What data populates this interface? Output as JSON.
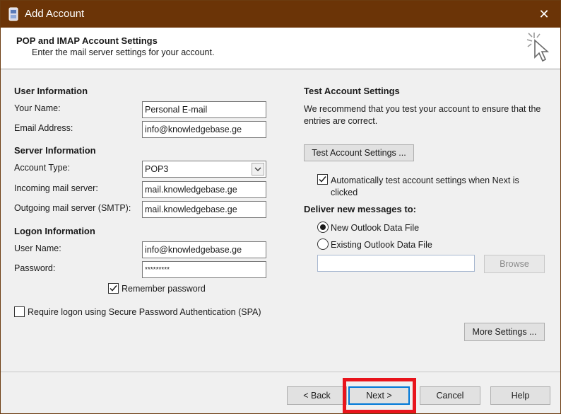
{
  "window": {
    "title": "Add Account",
    "close_label": "✕"
  },
  "header": {
    "title": "POP and IMAP Account Settings",
    "subtitle": "Enter the mail server settings for your account."
  },
  "user_info": {
    "heading": "User Information",
    "name_label": "Your Name:",
    "name_value": "Personal E-mail",
    "email_label": "Email Address:",
    "email_value": "info@knowledgebase.ge"
  },
  "server_info": {
    "heading": "Server Information",
    "account_type_label": "Account Type:",
    "account_type_value": "POP3",
    "incoming_label": "Incoming mail server:",
    "incoming_value": "mail.knowledgebase.ge",
    "outgoing_label": "Outgoing mail server (SMTP):",
    "outgoing_value": "mail.knowledgebase.ge"
  },
  "logon_info": {
    "heading": "Logon Information",
    "username_label": "User Name:",
    "username_value": "info@knowledgebase.ge",
    "password_label": "Password:",
    "password_value": "*********",
    "remember_label": "Remember password",
    "remember_checked": true,
    "spa_label": "Require logon using Secure Password Authentication (SPA)",
    "spa_checked": false
  },
  "test_settings": {
    "heading": "Test Account Settings",
    "description": "We recommend that you test your account to ensure that the entries are correct.",
    "test_button": "Test Account Settings ...",
    "auto_test_label": "Automatically test account settings when Next is clicked",
    "auto_test_checked": true
  },
  "deliver": {
    "heading": "Deliver new messages to:",
    "option_new": "New Outlook Data File",
    "option_existing": "Existing Outlook Data File",
    "selected": "New Outlook Data File",
    "existing_path": "",
    "browse_button": "Browse"
  },
  "more_settings_button": "More Settings ...",
  "footer": {
    "back": "< Back",
    "next": "Next >",
    "cancel": "Cancel",
    "help": "Help"
  },
  "colors": {
    "titlebar": "#6b3407",
    "highlight": "#e8141c"
  }
}
